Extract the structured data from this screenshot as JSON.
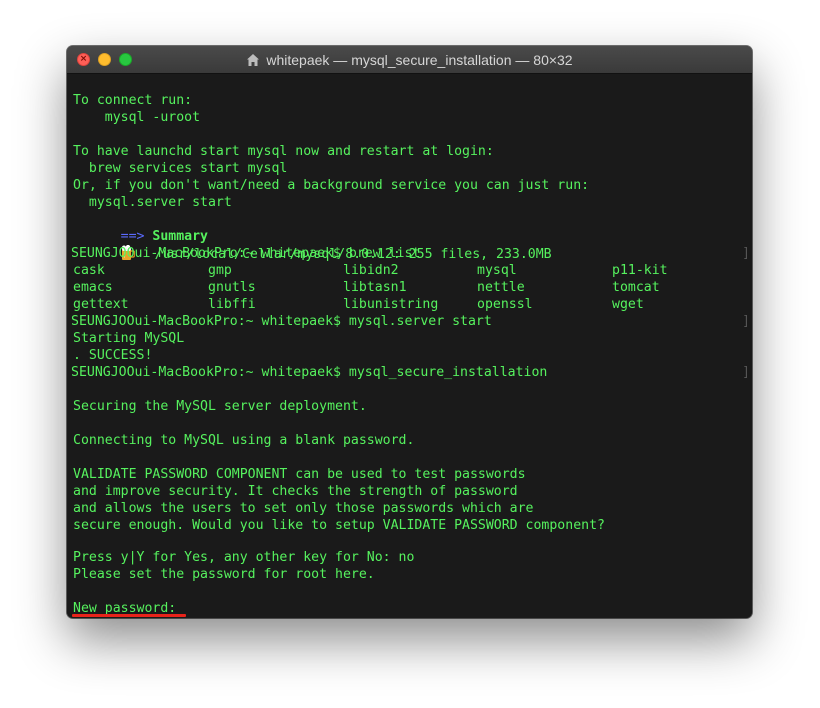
{
  "window": {
    "title": "whitepaek — mysql_secure_installation — 80×32",
    "home_icon": "house-icon",
    "colors": {
      "terminal_bg": "#1a1a1a",
      "text": "#56f25e",
      "arrow": "#5b6bff",
      "close": "#fe5f57",
      "minimize": "#febc2e",
      "zoom": "#28c840",
      "highlight_underline": "#e8231a"
    }
  },
  "terminal": {
    "lines": {
      "connect_hdr": "To connect run:",
      "connect_cmd": "    mysql -uroot",
      "launchd_hdr": "To have launchd start mysql now and restart at login:",
      "launchd_cmd": "  brew services start mysql",
      "or_line": "Or, if you don't want/need a background service you can just run:",
      "server_cmd": "  mysql.server start",
      "summary_arrow": "==>",
      "summary_label": "Summary",
      "beer_icon": "beer-mug-icon",
      "summary_path": "/usr/local/Cellar/mysql/8.0.12: 255 files, 233.0MB",
      "prompt_brew": "SEUNGJOOui-MacBookPro:~ whitepaek$ brew list",
      "prompt_server": "SEUNGJOOui-MacBookPro:~ whitepaek$ mysql.server start",
      "starting": "Starting MySQL",
      "success": ". SUCCESS!",
      "prompt_secure": "SEUNGJOOui-MacBookPro:~ whitepaek$ mysql_secure_installation",
      "securing": "Securing the MySQL server deployment.",
      "connecting": "Connecting to MySQL using a blank password.",
      "validate_1": "VALIDATE PASSWORD COMPONENT can be used to test passwords",
      "validate_2": "and improve security. It checks the strength of password",
      "validate_3": "and allows the users to set only those passwords which are",
      "validate_4": "secure enough. Would you like to setup VALIDATE PASSWORD component?",
      "press": "Press y|Y for Yes, any other key for No: no",
      "please_set": "Please set the password for root here.",
      "new_password": "New password:"
    },
    "brew_list": [
      [
        "cask",
        "gmp",
        "libidn2",
        "mysql",
        "p11-kit"
      ],
      [
        "emacs",
        "gnutls",
        "libtasn1",
        "nettle",
        "tomcat"
      ],
      [
        "gettext",
        "libffi",
        "libunistring",
        "openssl",
        "wget"
      ]
    ]
  }
}
